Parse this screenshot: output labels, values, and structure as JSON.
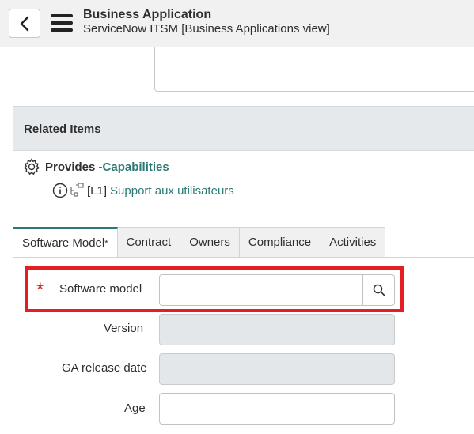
{
  "header": {
    "title": "Business Application",
    "subtitle": "ServiceNow ITSM [Business Applications view]"
  },
  "related": {
    "heading": "Related Items",
    "provides_label": "Provides - ",
    "provides_link": "Capabilities",
    "capability_prefix": "[L1]",
    "capability_link": "Support aux utilisateurs"
  },
  "tabs": [
    {
      "label": "Software Model",
      "required_mark": "*",
      "active": true
    },
    {
      "label": "Contract"
    },
    {
      "label": "Owners"
    },
    {
      "label": "Compliance"
    },
    {
      "label": "Activities"
    }
  ],
  "form": {
    "software_model": {
      "label": "Software model",
      "required_mark": "*",
      "value": ""
    },
    "version": {
      "label": "Version",
      "value": ""
    },
    "ga_release_date": {
      "label": "GA release date",
      "value": ""
    },
    "age": {
      "label": "Age",
      "value": ""
    }
  },
  "colors": {
    "accent": "#2a7b78",
    "highlight": "#e31e24",
    "required": "#d4232c"
  }
}
